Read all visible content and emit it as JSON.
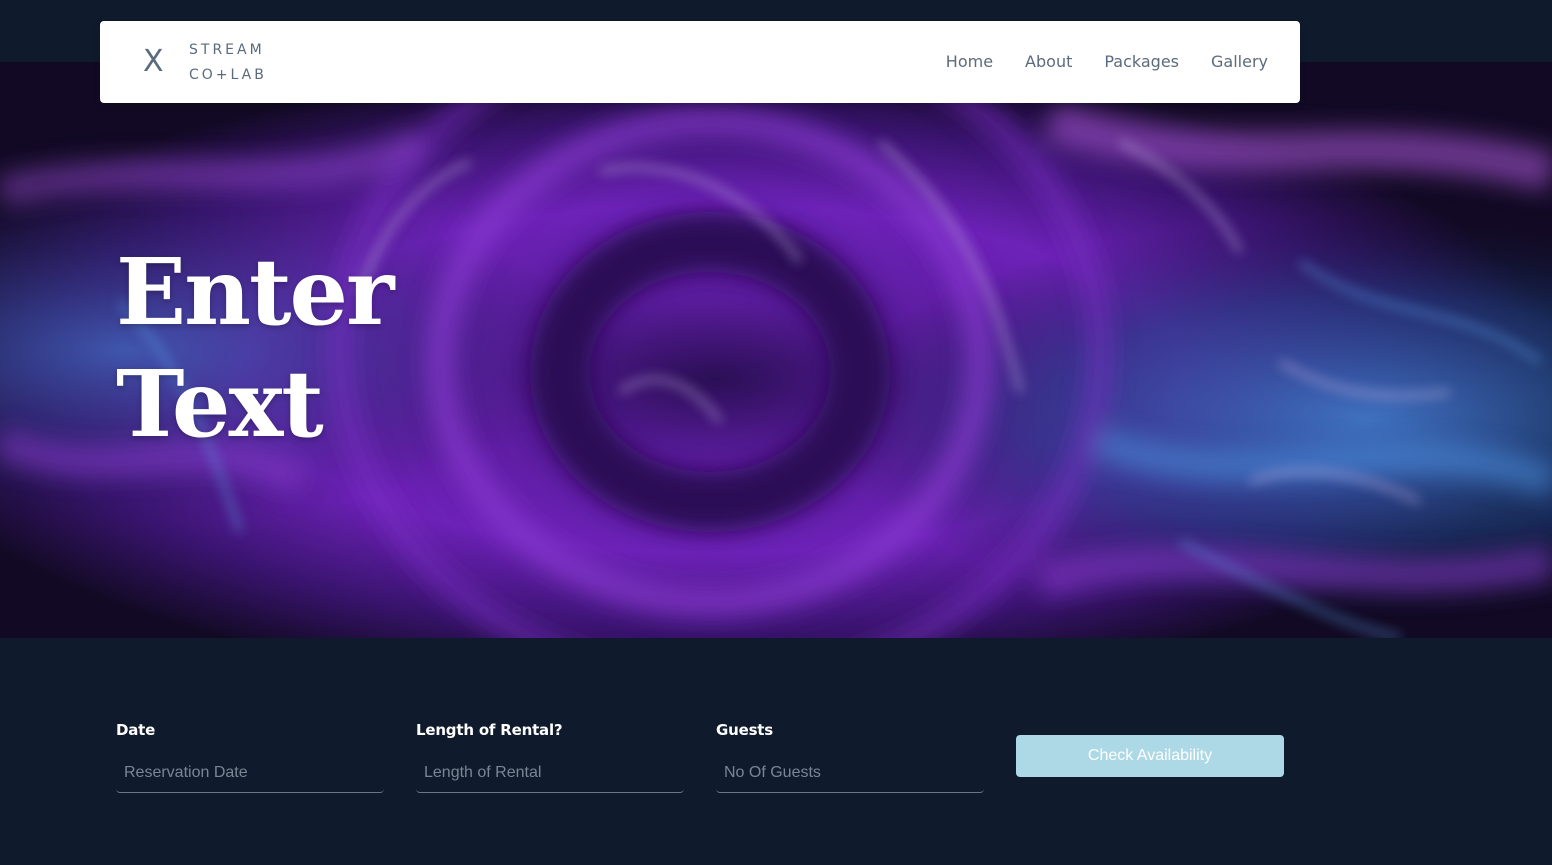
{
  "brand": {
    "mark": "X",
    "line1": "STREAM",
    "line2": "CO+LAB"
  },
  "nav": {
    "home": "Home",
    "about": "About",
    "packages": "Packages",
    "gallery": "Gallery"
  },
  "hero": {
    "line1": "Enter",
    "line2": "Text"
  },
  "booking": {
    "date_label": "Date",
    "date_placeholder": "Reservation Date",
    "length_label": "Length of Rental?",
    "length_placeholder": "Length of Rental",
    "guests_label": "Guests",
    "guests_placeholder": "No Of Guests",
    "check_button": "Check Availability"
  },
  "colors": {
    "page_bg": "#0f1a2c",
    "button_bg": "#add8e6",
    "nav_text": "#5b6b7d"
  }
}
